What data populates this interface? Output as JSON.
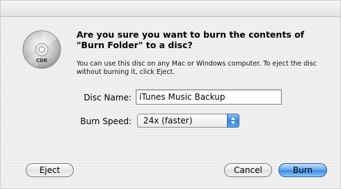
{
  "dialog": {
    "title": "Are you sure you want to burn the contents of \"Burn Folder\" to a disc?",
    "message": "You can use this disc on any Mac or Windows computer. To eject the disc without burning it, click Eject.",
    "icon": "cd-r-disc-icon",
    "icon_text": "CDR"
  },
  "form": {
    "disc_name_label": "Disc Name:",
    "disc_name_value": "iTunes Music Backup",
    "burn_speed_label": "Burn Speed:",
    "burn_speed_value": "24x (faster)"
  },
  "buttons": {
    "eject": "Eject",
    "cancel": "Cancel",
    "burn": "Burn"
  },
  "colors": {
    "default_button": "#3d8be2",
    "sheet_background": "#eeeeee"
  }
}
